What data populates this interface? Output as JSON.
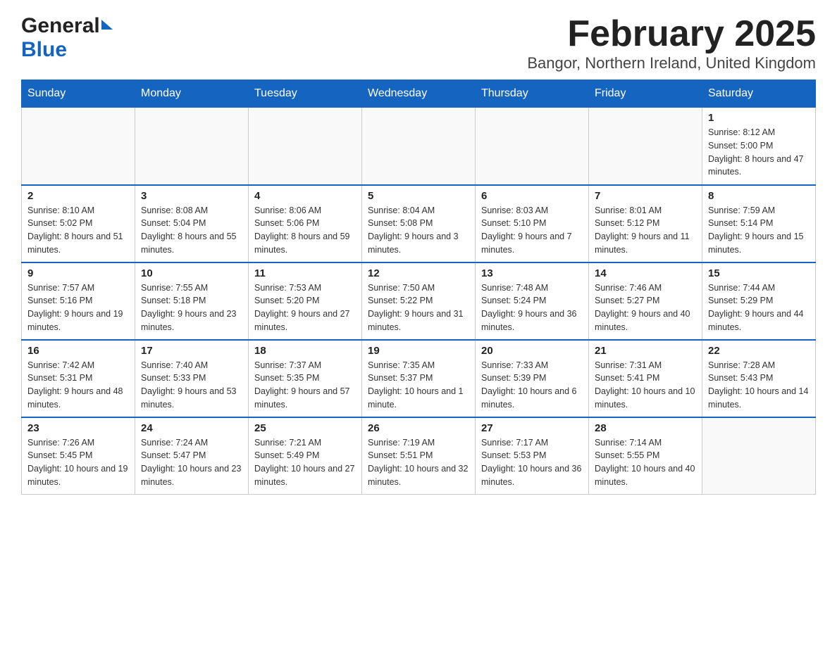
{
  "logo": {
    "general": "General",
    "blue": "Blue"
  },
  "header": {
    "month": "February 2025",
    "location": "Bangor, Northern Ireland, United Kingdom"
  },
  "days_of_week": [
    "Sunday",
    "Monday",
    "Tuesday",
    "Wednesday",
    "Thursday",
    "Friday",
    "Saturday"
  ],
  "weeks": [
    [
      {
        "day": "",
        "info": ""
      },
      {
        "day": "",
        "info": ""
      },
      {
        "day": "",
        "info": ""
      },
      {
        "day": "",
        "info": ""
      },
      {
        "day": "",
        "info": ""
      },
      {
        "day": "",
        "info": ""
      },
      {
        "day": "1",
        "info": "Sunrise: 8:12 AM\nSunset: 5:00 PM\nDaylight: 8 hours and 47 minutes."
      }
    ],
    [
      {
        "day": "2",
        "info": "Sunrise: 8:10 AM\nSunset: 5:02 PM\nDaylight: 8 hours and 51 minutes."
      },
      {
        "day": "3",
        "info": "Sunrise: 8:08 AM\nSunset: 5:04 PM\nDaylight: 8 hours and 55 minutes."
      },
      {
        "day": "4",
        "info": "Sunrise: 8:06 AM\nSunset: 5:06 PM\nDaylight: 8 hours and 59 minutes."
      },
      {
        "day": "5",
        "info": "Sunrise: 8:04 AM\nSunset: 5:08 PM\nDaylight: 9 hours and 3 minutes."
      },
      {
        "day": "6",
        "info": "Sunrise: 8:03 AM\nSunset: 5:10 PM\nDaylight: 9 hours and 7 minutes."
      },
      {
        "day": "7",
        "info": "Sunrise: 8:01 AM\nSunset: 5:12 PM\nDaylight: 9 hours and 11 minutes."
      },
      {
        "day": "8",
        "info": "Sunrise: 7:59 AM\nSunset: 5:14 PM\nDaylight: 9 hours and 15 minutes."
      }
    ],
    [
      {
        "day": "9",
        "info": "Sunrise: 7:57 AM\nSunset: 5:16 PM\nDaylight: 9 hours and 19 minutes."
      },
      {
        "day": "10",
        "info": "Sunrise: 7:55 AM\nSunset: 5:18 PM\nDaylight: 9 hours and 23 minutes."
      },
      {
        "day": "11",
        "info": "Sunrise: 7:53 AM\nSunset: 5:20 PM\nDaylight: 9 hours and 27 minutes."
      },
      {
        "day": "12",
        "info": "Sunrise: 7:50 AM\nSunset: 5:22 PM\nDaylight: 9 hours and 31 minutes."
      },
      {
        "day": "13",
        "info": "Sunrise: 7:48 AM\nSunset: 5:24 PM\nDaylight: 9 hours and 36 minutes."
      },
      {
        "day": "14",
        "info": "Sunrise: 7:46 AM\nSunset: 5:27 PM\nDaylight: 9 hours and 40 minutes."
      },
      {
        "day": "15",
        "info": "Sunrise: 7:44 AM\nSunset: 5:29 PM\nDaylight: 9 hours and 44 minutes."
      }
    ],
    [
      {
        "day": "16",
        "info": "Sunrise: 7:42 AM\nSunset: 5:31 PM\nDaylight: 9 hours and 48 minutes."
      },
      {
        "day": "17",
        "info": "Sunrise: 7:40 AM\nSunset: 5:33 PM\nDaylight: 9 hours and 53 minutes."
      },
      {
        "day": "18",
        "info": "Sunrise: 7:37 AM\nSunset: 5:35 PM\nDaylight: 9 hours and 57 minutes."
      },
      {
        "day": "19",
        "info": "Sunrise: 7:35 AM\nSunset: 5:37 PM\nDaylight: 10 hours and 1 minute."
      },
      {
        "day": "20",
        "info": "Sunrise: 7:33 AM\nSunset: 5:39 PM\nDaylight: 10 hours and 6 minutes."
      },
      {
        "day": "21",
        "info": "Sunrise: 7:31 AM\nSunset: 5:41 PM\nDaylight: 10 hours and 10 minutes."
      },
      {
        "day": "22",
        "info": "Sunrise: 7:28 AM\nSunset: 5:43 PM\nDaylight: 10 hours and 14 minutes."
      }
    ],
    [
      {
        "day": "23",
        "info": "Sunrise: 7:26 AM\nSunset: 5:45 PM\nDaylight: 10 hours and 19 minutes."
      },
      {
        "day": "24",
        "info": "Sunrise: 7:24 AM\nSunset: 5:47 PM\nDaylight: 10 hours and 23 minutes."
      },
      {
        "day": "25",
        "info": "Sunrise: 7:21 AM\nSunset: 5:49 PM\nDaylight: 10 hours and 27 minutes."
      },
      {
        "day": "26",
        "info": "Sunrise: 7:19 AM\nSunset: 5:51 PM\nDaylight: 10 hours and 32 minutes."
      },
      {
        "day": "27",
        "info": "Sunrise: 7:17 AM\nSunset: 5:53 PM\nDaylight: 10 hours and 36 minutes."
      },
      {
        "day": "28",
        "info": "Sunrise: 7:14 AM\nSunset: 5:55 PM\nDaylight: 10 hours and 40 minutes."
      },
      {
        "day": "",
        "info": ""
      }
    ]
  ]
}
